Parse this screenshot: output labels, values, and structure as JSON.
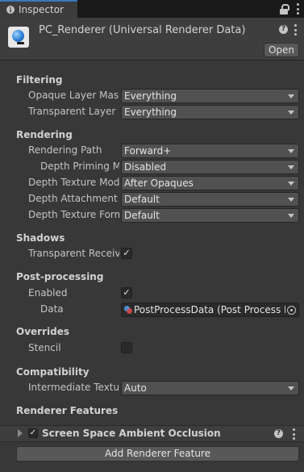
{
  "tab": {
    "title": "Inspector",
    "icon": "info-icon",
    "lock_icon": "lock-icon",
    "menu_icon": "kebab-menu-icon"
  },
  "header": {
    "title": "PC_Renderer (Universal Renderer Data)",
    "open_label": "Open",
    "asset_icon": "renderer-asset-icon"
  },
  "sections": {
    "filtering": {
      "title": "Filtering",
      "opaque_label": "Opaque Layer Mask",
      "opaque_value": "Everything",
      "transparent_label": "Transparent Layer Mask",
      "transparent_value": "Everything"
    },
    "rendering": {
      "title": "Rendering",
      "path_label": "Rendering Path",
      "path_value": "Forward+",
      "priming_label": "Depth Priming Mode",
      "priming_value": "Disabled",
      "texture_mode_label": "Depth Texture Mode",
      "texture_mode_value": "After Opaques",
      "attachment_label": "Depth Attachment Format",
      "attachment_value": "Default",
      "texture_format_label": "Depth Texture Format",
      "texture_format_value": "Default"
    },
    "shadows": {
      "title": "Shadows",
      "transparent_receive_label": "Transparent Receive Shadows",
      "transparent_receive_checked": "✓"
    },
    "postprocessing": {
      "title": "Post-processing",
      "enabled_label": "Enabled",
      "enabled_checked": "✓",
      "data_label": "Data",
      "data_value": "PostProcessData (Post Process Data)"
    },
    "overrides": {
      "title": "Overrides",
      "stencil_label": "Stencil",
      "stencil_checked": ""
    },
    "compatibility": {
      "title": "Compatibility",
      "intermediate_label": "Intermediate Texture",
      "intermediate_value": "Auto"
    },
    "renderer_features": {
      "title": "Renderer Features",
      "feature_name": "Screen Space Ambient Occlusion",
      "feature_checked": "✓",
      "add_label": "Add Renderer Feature"
    }
  }
}
